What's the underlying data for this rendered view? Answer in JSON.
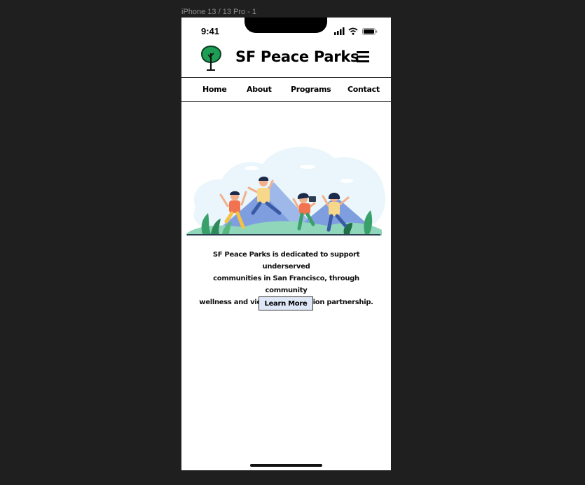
{
  "frame": {
    "label": "iPhone 13 / 13 Pro - 1"
  },
  "status_bar": {
    "time": "9:41"
  },
  "header": {
    "title": "SF Peace Parks",
    "logo_icon": "tree-icon",
    "menu_icon": "hamburger-menu-icon"
  },
  "nav": {
    "items": [
      {
        "label": "Home"
      },
      {
        "label": "About"
      },
      {
        "label": "Programs"
      },
      {
        "label": "Contact"
      }
    ]
  },
  "hero": {
    "illustration": "people-jumping-in-park-illustration"
  },
  "main": {
    "tagline_lines": [
      "SF Peace Parks is dedicated to support underserved",
      "communities in San Francisco, through community",
      "wellness and violence prevention partnership."
    ],
    "cta_label": "Learn More"
  },
  "colors": {
    "accent_green": "#1e9e55",
    "button_bg": "#dfe8f7",
    "frame_bg": "#1f1f1f"
  }
}
